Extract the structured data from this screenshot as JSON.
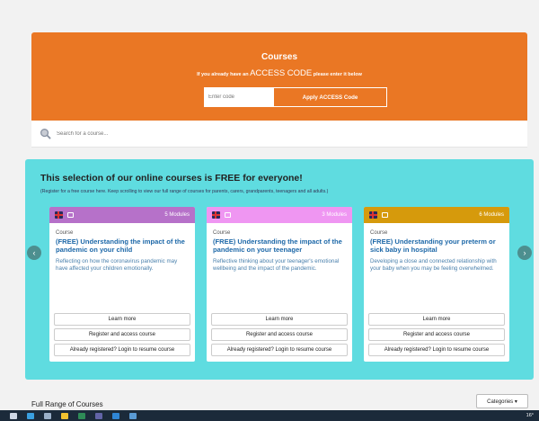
{
  "hero": {
    "title": "Courses",
    "sub_before": "If you already have an",
    "sub_code": "ACCESS CODE",
    "sub_after": "please enter it below",
    "code_placeholder": "Enter code",
    "apply_label": "Apply ACCESS Code",
    "color": "#ea7724"
  },
  "search": {
    "placeholder": "Search for a course..."
  },
  "free_section": {
    "title": "This selection of our online courses is FREE for everyone!",
    "note": "(Register for a free course here. Keep scrolling to view our full range of courses for parents, carers, grandparents, teenagers and all adults.)",
    "prev_icon": "chevron-left-icon",
    "next_icon": "chevron-right-icon",
    "prev_label": "‹",
    "next_label": "›",
    "color": "#5fdce0"
  },
  "cards": [
    {
      "header_color": "#b671c9",
      "modules": "5 Modules",
      "label": "Course",
      "title": "(FREE) Understanding the impact of the pandemic on your child",
      "desc": "Reflecting on how the coronavirus pandemic may have affected your children emotionally.",
      "learn": "Learn more",
      "register": "Register and access course",
      "login": "Already registered? Login to resume course"
    },
    {
      "header_color": "#ef96f2",
      "modules": "3 Modules",
      "label": "Course",
      "title": "(FREE) Understanding the impact of the pandemic on your teenager",
      "desc": "Reflective thinking about your teenager's emotional wellbeing and the impact of the pandemic.",
      "learn": "Learn more",
      "register": "Register and access course",
      "login": "Already registered? Login to resume course"
    },
    {
      "header_color": "#d69a0c",
      "modules": "6 Modules",
      "label": "Course",
      "title": "(FREE) Understanding your preterm or sick baby in hospital",
      "desc": "Developing a close and connected relationship with your baby when you may be feeling overwhelmed.",
      "learn": "Learn more",
      "register": "Register and access course",
      "login": "Already registered? Login to resume course"
    }
  ],
  "full_range": {
    "title": "Full Range of Courses",
    "categories_label": "Categories ▾"
  },
  "taskbar": {
    "icons": [
      "windows-start-icon",
      "search-icon",
      "task-view-icon",
      "file-explorer-icon",
      "excel-icon",
      "teams-icon",
      "edge-icon",
      "app-icon"
    ],
    "icon_colors": [
      "#cfd8e6",
      "#3aa0e0",
      "#9bb0c8",
      "#f2c230",
      "#2e8b57",
      "#6264a7",
      "#2f86d6",
      "#5a9bd5"
    ],
    "tray_text": "16°"
  }
}
